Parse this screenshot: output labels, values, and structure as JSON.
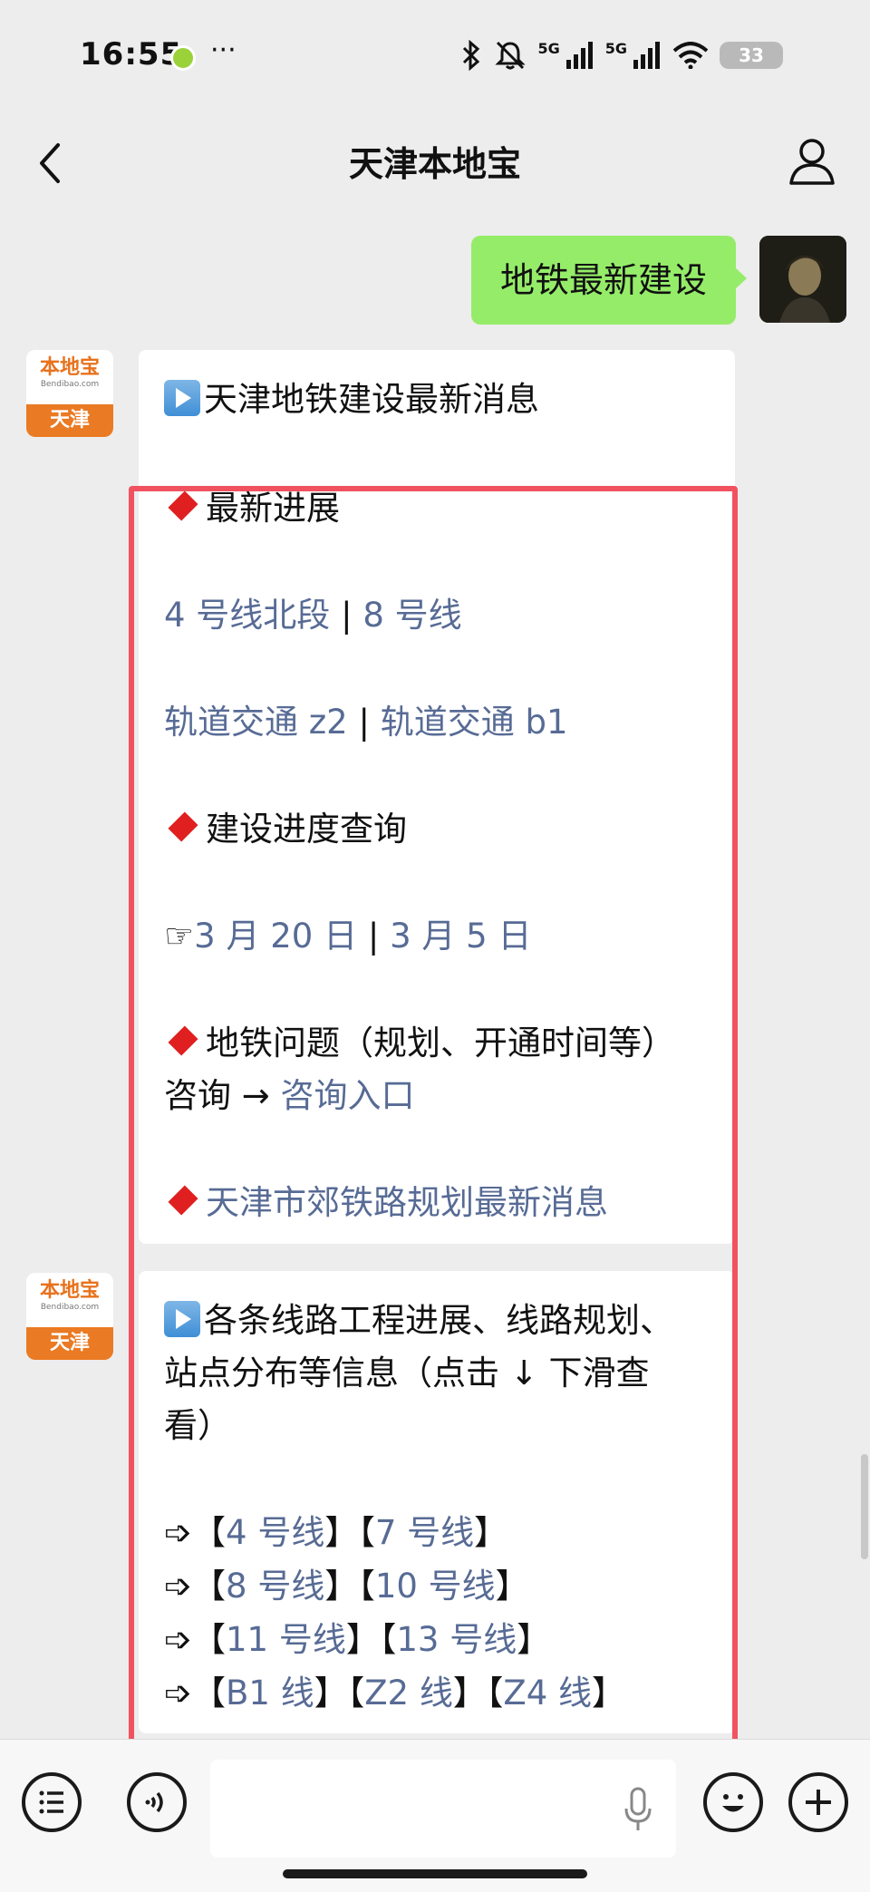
{
  "status_bar": {
    "time": "16:55",
    "more": "···",
    "signal_label_1": "5G",
    "signal_label_2": "5G",
    "battery": "33",
    "icons": [
      "app-notification-icon",
      "bluetooth-icon",
      "mute-icon",
      "signal-icon",
      "wifi-icon",
      "battery-icon"
    ]
  },
  "nav": {
    "title": "天津本地宝",
    "back_icon": "chevron-left-icon",
    "profile_icon": "person-icon"
  },
  "avatar": {
    "logo_cn": "本地宝",
    "logo_en": "Bendibao.com",
    "city": "天津"
  },
  "user_message": "地铁最新建设",
  "msg1": {
    "title": "天津地铁建设最新消息",
    "latest_heading": "最新进展",
    "links_row1": [
      "4 号线北段",
      "8 号线"
    ],
    "links_row2": [
      "轨道交通 z2",
      "轨道交通 b1"
    ],
    "query_heading": "建设进度查询",
    "pointer": "☞",
    "dates": [
      "3 月 20 日",
      "3 月 5 日"
    ],
    "issue_heading": "地铁问题（规划、开通时间等）",
    "consult_label": "咨询 →",
    "consult_link": "咨询入口",
    "suburban_link": "天津市郊铁路规划最新消息"
  },
  "msg2": {
    "title_line1": "各条线路工程进展、线路规划、",
    "title_line2": "站点分布等信息（点击 ↓ 下滑查",
    "title_line3": "看）",
    "arrow": "➩",
    "rows": [
      [
        "4 号线",
        "7 号线"
      ],
      [
        "8 号线",
        "10 号线"
      ],
      [
        "11 号线",
        "13 号线"
      ],
      [
        "B1 线",
        "Z2 线",
        "Z4 线"
      ]
    ]
  },
  "separator": "|",
  "bracket_open": "【",
  "bracket_close": "】",
  "toolbar": {
    "menu_icon": "list-menu-icon",
    "voice_icon": "voice-icon",
    "mic_icon": "microphone-icon",
    "emoji_icon": "emoji-icon",
    "plus_icon": "plus-icon",
    "input_value": ""
  },
  "colors": {
    "background": "#ededed",
    "user_bubble": "#95ec69",
    "link": "#576b95",
    "highlight_box": "#f1525f",
    "diamond": "#e02020",
    "logo_orange": "#ea7a23"
  }
}
